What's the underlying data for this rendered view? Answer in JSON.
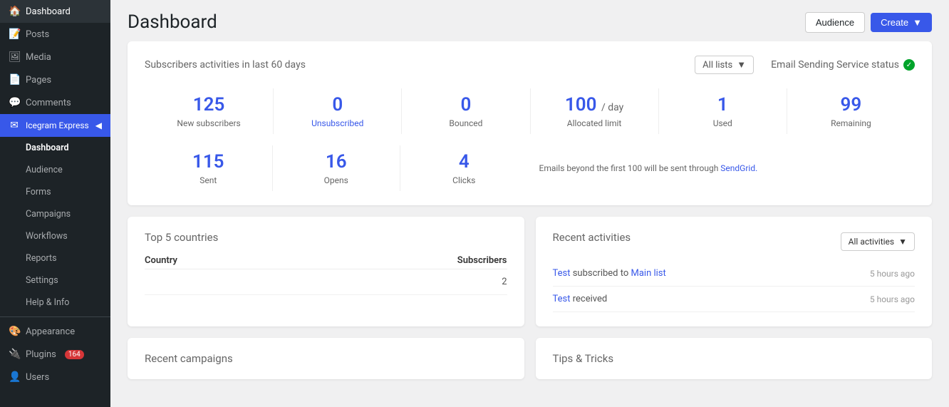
{
  "sidebar": {
    "items": [
      {
        "id": "dashboard",
        "label": "Dashboard",
        "icon": "🏠",
        "active": false
      },
      {
        "id": "posts",
        "label": "Posts",
        "icon": "📝",
        "active": false
      },
      {
        "id": "media",
        "label": "Media",
        "icon": "🖼",
        "active": false
      },
      {
        "id": "pages",
        "label": "Pages",
        "icon": "📄",
        "active": false
      },
      {
        "id": "comments",
        "label": "Comments",
        "icon": "💬",
        "active": false
      },
      {
        "id": "icegram",
        "label": "Icegram Express",
        "icon": "✉",
        "active": true,
        "highlighted": true
      },
      {
        "id": "sub-dashboard",
        "label": "Dashboard",
        "sub": true,
        "active": true
      },
      {
        "id": "sub-audience",
        "label": "Audience",
        "sub": true
      },
      {
        "id": "sub-forms",
        "label": "Forms",
        "sub": true
      },
      {
        "id": "sub-campaigns",
        "label": "Campaigns",
        "sub": true
      },
      {
        "id": "sub-workflows",
        "label": "Workflows",
        "sub": true
      },
      {
        "id": "sub-reports",
        "label": "Reports",
        "sub": true
      },
      {
        "id": "sub-settings",
        "label": "Settings",
        "sub": true
      },
      {
        "id": "sub-help",
        "label": "Help & Info",
        "sub": true
      },
      {
        "id": "appearance",
        "label": "Appearance",
        "icon": "🎨",
        "active": false
      },
      {
        "id": "plugins",
        "label": "Plugins",
        "icon": "🔌",
        "active": false,
        "badge": "164"
      },
      {
        "id": "users",
        "label": "Users",
        "icon": "👤",
        "active": false
      }
    ]
  },
  "header": {
    "title": "Dashboard",
    "audience_label": "Audience",
    "create_label": "Create"
  },
  "activities_card": {
    "title": "Subscribers activities in last 60 days",
    "list_select": "All lists",
    "email_status_title": "Email Sending Service status",
    "stats_row1": [
      {
        "value": "125",
        "label": "New subscribers"
      },
      {
        "value": "0",
        "label": "Unsubscribed",
        "blue_label": true
      },
      {
        "value": "0",
        "label": "Bounced"
      },
      {
        "value": "100",
        "label": "Allocated limit",
        "suffix": " / day"
      },
      {
        "value": "1",
        "label": "Used"
      },
      {
        "value": "99",
        "label": "Remaining"
      }
    ],
    "stats_row2": [
      {
        "value": "115",
        "label": "Sent"
      },
      {
        "value": "16",
        "label": "Opens"
      },
      {
        "value": "4",
        "label": "Clicks"
      }
    ],
    "sendgrid_note": "Emails beyond the first 100 will be sent through",
    "sendgrid_link": "SendGrid."
  },
  "top_countries": {
    "title": "Top 5 countries",
    "col_country": "Country",
    "col_subscribers": "Subscribers",
    "rows": [
      {
        "country": "",
        "subscribers": "2"
      }
    ]
  },
  "recent_activities": {
    "title": "Recent activities",
    "filter_label": "All activities",
    "activities": [
      {
        "link1": "Test",
        "text1": " subscribed to ",
        "link2": "Main list",
        "time": "5 hours ago"
      },
      {
        "link1": "Test",
        "text1": " received",
        "link2": "",
        "time": "5 hours ago"
      }
    ]
  },
  "bottom": {
    "recent_campaigns_title": "Recent campaigns",
    "tips_title": "Tips & Tricks"
  }
}
